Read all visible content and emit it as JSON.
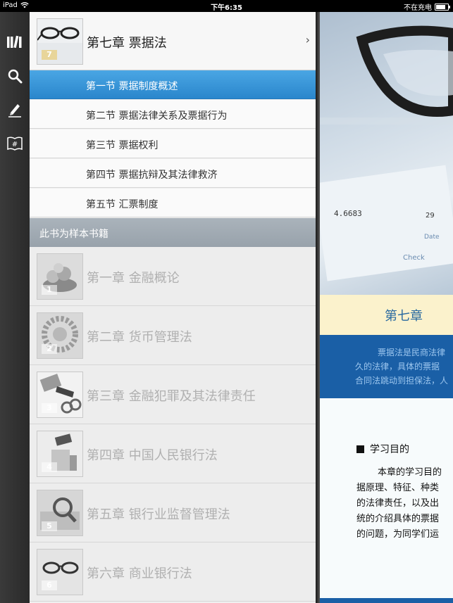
{
  "status_bar": {
    "device": "iPad",
    "time": "下午6:35",
    "charging": "不在充电"
  },
  "toolbar": {
    "icons": [
      "library-icon",
      "search-icon",
      "pencil-icon",
      "bookmark-hash-icon"
    ]
  },
  "current_chapter": {
    "number": "7",
    "title": "第七章 票据法",
    "sections": [
      "第一节 票据制度概述",
      "第二节 票据法律关系及票据行为",
      "第三节 票据权利",
      "第四节 票据抗辩及其法律救济",
      "第五节 汇票制度"
    ],
    "active_section_index": 0
  },
  "sample_notice": "此书为样本书籍",
  "chapters": [
    {
      "number": "1",
      "title": "第一章 金融概论"
    },
    {
      "number": "2",
      "title": "第二章 货币管理法"
    },
    {
      "number": "3",
      "title": "第三章 金融犯罪及其法律责任"
    },
    {
      "number": "4",
      "title": "第四章 中国人民银行法"
    },
    {
      "number": "5",
      "title": "第五章 银行业监督管理法"
    },
    {
      "number": "6",
      "title": "第六章 商业银行法"
    }
  ],
  "page": {
    "chapter_label": "第七章",
    "intro_lines": [
      "票据法是民商法律",
      "久的法律，具体的票据",
      "合同法跳动到担保法，人"
    ],
    "objectives_heading": "学习目的",
    "objectives_lines": [
      "本章的学习目的",
      "据原理、特征、种类",
      "的法律责任，以及出",
      "统的介绍具体的票据",
      "的问题，为同学们运"
    ]
  }
}
